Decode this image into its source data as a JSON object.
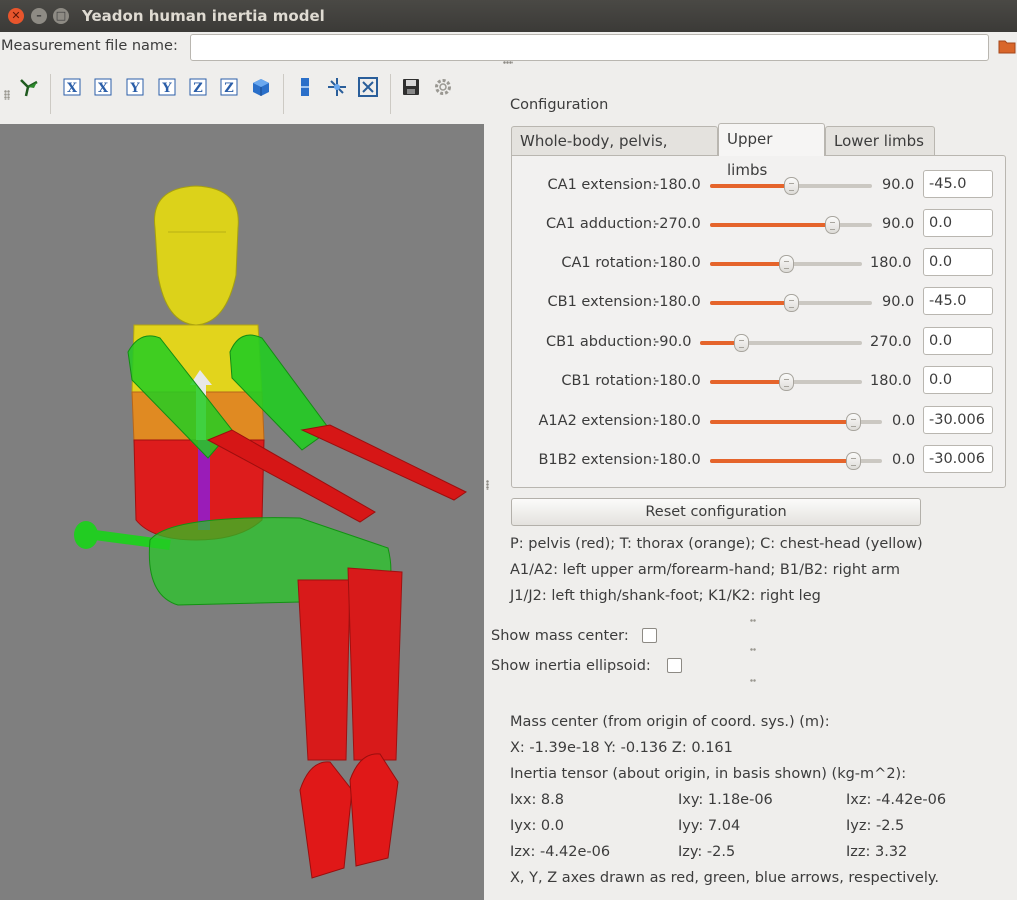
{
  "window": {
    "title": "Yeadon human inertia model"
  },
  "measurement": {
    "label": "Measurement file name:",
    "value": ""
  },
  "toolbar": {
    "buttons": [
      "view-isometric-icon",
      "view-x-icon",
      "view-neg-x-icon",
      "view-y-icon",
      "view-neg-y-icon",
      "view-z-icon",
      "view-neg-z-icon",
      "view-3d-cube-icon",
      "camera-pan-icon",
      "camera-rotate-icon",
      "fit-to-window-icon",
      "save-icon",
      "settings-gear-icon"
    ]
  },
  "config": {
    "title": "Configuration",
    "tabs": [
      "Whole-body, pelvis, torso",
      "Upper limbs",
      "Lower limbs"
    ],
    "active_tab": "Upper limbs",
    "sliders": [
      {
        "label": "CA1 extension:",
        "min": "-180.0",
        "max": "90.0",
        "value": "-45.0",
        "fraction": 0.5
      },
      {
        "label": "CA1 adduction:",
        "min": "-270.0",
        "max": "90.0",
        "value": "0.0",
        "fraction": 0.75
      },
      {
        "label": "CA1 rotation:",
        "min": "-180.0",
        "max": "180.0",
        "value": "0.0",
        "fraction": 0.5
      },
      {
        "label": "CB1 extension:",
        "min": "-180.0",
        "max": "90.0",
        "value": "-45.0",
        "fraction": 0.5
      },
      {
        "label": "CB1 abduction:",
        "min": "-90.0",
        "max": "270.0",
        "value": "0.0",
        "fraction": 0.25
      },
      {
        "label": "CB1 rotation:",
        "min": "-180.0",
        "max": "180.0",
        "value": "0.0",
        "fraction": 0.5
      },
      {
        "label": "A1A2 extension:",
        "min": "-180.0",
        "max": "0.0",
        "value": "-30.006",
        "fraction": 0.833
      },
      {
        "label": "B1B2 extension:",
        "min": "-180.0",
        "max": "0.0",
        "value": "-30.006",
        "fraction": 0.833
      }
    ],
    "reset_label": "Reset configuration"
  },
  "legend": {
    "line1": "P: pelvis (red); T: thorax (orange); C: chest-head (yellow)",
    "line2": "A1/A2: left upper arm/forearm-hand; B1/B2: right arm",
    "line3": "J1/J2: left thigh/shank-foot; K1/K2: right leg"
  },
  "options": {
    "show_mass_center": "Show mass center:",
    "show_inertia_ellipsoid": "Show inertia ellipsoid:"
  },
  "results": {
    "mass_center_title": "Mass center (from origin of coord. sys.) (m):",
    "mass_center": "X:  -1.39e-18  Y:  -0.136  Z:  0.161",
    "inertia_title": "Inertia tensor (about origin, in basis shown) (kg-m^2):",
    "ixx": "Ixx:  8.8",
    "ixy": "Ixy:  1.18e-06",
    "ixz": "Ixz:  -4.42e-06",
    "iyx": "Iyx:  0.0",
    "iyy": "Iyy:  7.04",
    "iyz": "Iyz:  -2.5",
    "izx": "Izx:  -4.42e-06",
    "izy": "Izy:  -2.5",
    "izz": "Izz:  3.32",
    "axes_note": "X, Y, Z axes drawn as red, green, blue arrows, respectively."
  },
  "colors": {
    "accent": "#e5642b",
    "viewport_bg": "#7f7f7f",
    "pelvis": "#e01818",
    "thorax": "#e07a1e",
    "head": "#e6d81a",
    "arms": "#22cc22"
  }
}
